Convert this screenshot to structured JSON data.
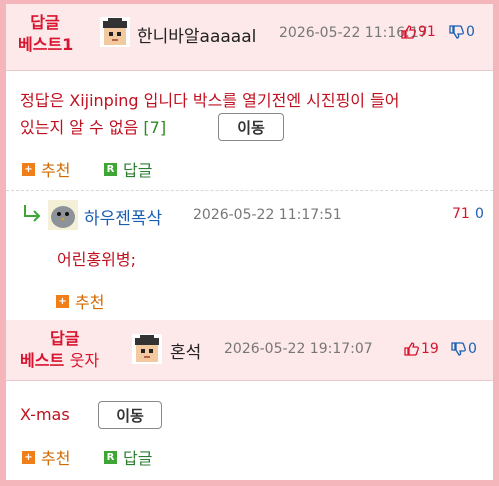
{
  "comments": [
    {
      "best_label_1": "답글",
      "best_label_2": "베스트1",
      "nickname": "한니바알aaaaal",
      "timestamp": "2026-05-22 11:16:17",
      "upvotes": "91",
      "downvotes": "0",
      "body_line1": "정답은 Xijinping 입니다 박스를 열기전엔 시진핑이 들어",
      "body_line2": "있는지 알 수 없음",
      "reply_count": "[7]",
      "move_label": "이동",
      "recommend_label": "추천",
      "reply_label": "답글"
    },
    {
      "nickname": "하우젠폭삭",
      "timestamp": "2026-05-22 11:17:51",
      "upvotes": "71",
      "downvotes": "0",
      "body": "어린홍위병;",
      "recommend_label": "추천"
    },
    {
      "best_label_1": "답글",
      "best_label_2": "베스트",
      "best_suffix": "웃자",
      "nickname": "혼석",
      "timestamp": "2026-05-22 19:17:07",
      "upvotes": "19",
      "downvotes": "0",
      "body": "X-mas",
      "move_label": "이동",
      "recommend_label": "추천",
      "reply_label": "답글"
    }
  ],
  "icons": {
    "recommend": "plus-square-icon",
    "reply": "r-square-icon",
    "thumb_up": "thumbs-up-icon",
    "thumb_down": "thumbs-down-icon",
    "reply_arrow": "reply-arrow-icon"
  },
  "colors": {
    "accent_red": "#d8132e",
    "frame_pink": "#f5b6bb",
    "band_pink": "#fde8ea",
    "reply_blue": "#1a5fb4",
    "recommend_orange": "#f07f1a",
    "reply_green": "#3fa535"
  }
}
